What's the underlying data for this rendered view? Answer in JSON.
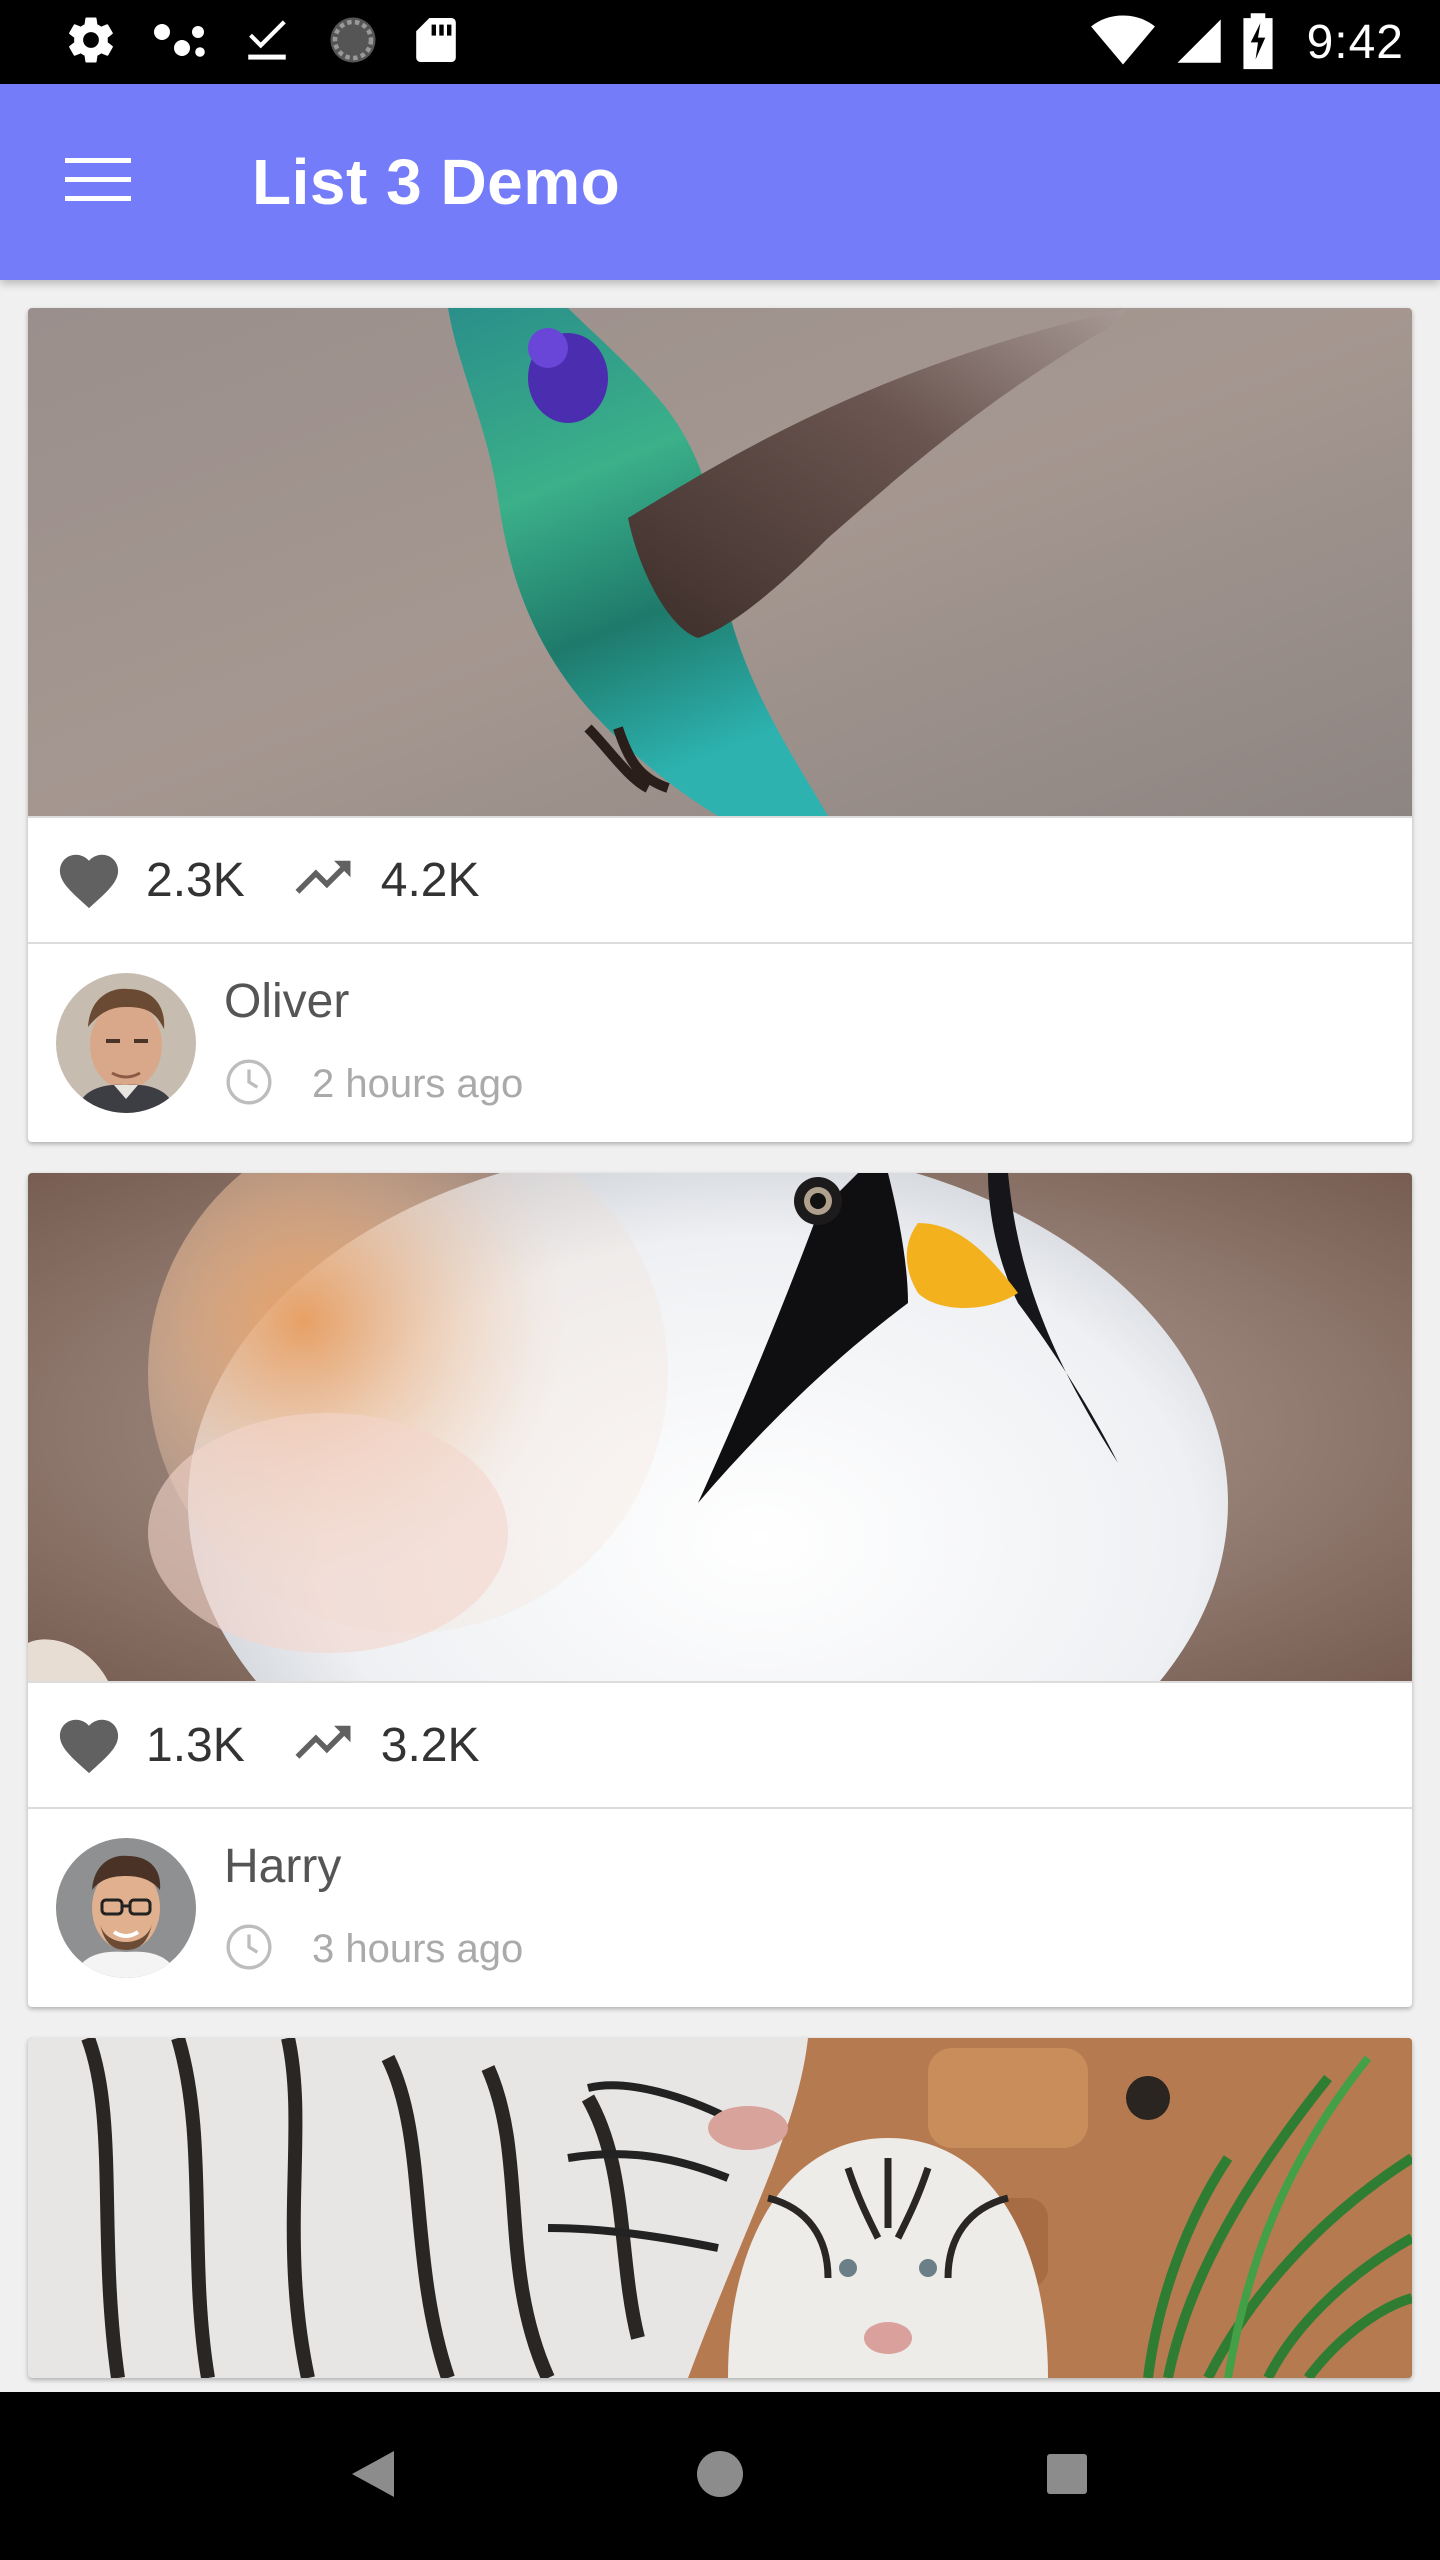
{
  "status_bar": {
    "time": "9:42",
    "icons": [
      "settings-icon",
      "dots-icon",
      "download-done-icon",
      "sync-icon",
      "sd-card-icon",
      "wifi-icon",
      "cell-signal-icon",
      "battery-charging-icon"
    ]
  },
  "app_bar": {
    "title": "List 3 Demo",
    "menu_icon": "menu-icon",
    "color": "#747cf9"
  },
  "feed": {
    "cards": [
      {
        "image": "hummingbird-photo",
        "likes": "2.3K",
        "views": "4.2K",
        "author": "Oliver",
        "time": "2 hours ago",
        "avatar": "avatar-oliver"
      },
      {
        "image": "bearded-reedling-bird-photo",
        "likes": "1.3K",
        "views": "3.2K",
        "author": "Harry",
        "time": "3 hours ago",
        "avatar": "avatar-harry"
      },
      {
        "image": "white-tigers-photo"
      }
    ]
  },
  "nav_bar": {
    "buttons": [
      "back-icon",
      "home-icon",
      "recents-icon"
    ]
  }
}
